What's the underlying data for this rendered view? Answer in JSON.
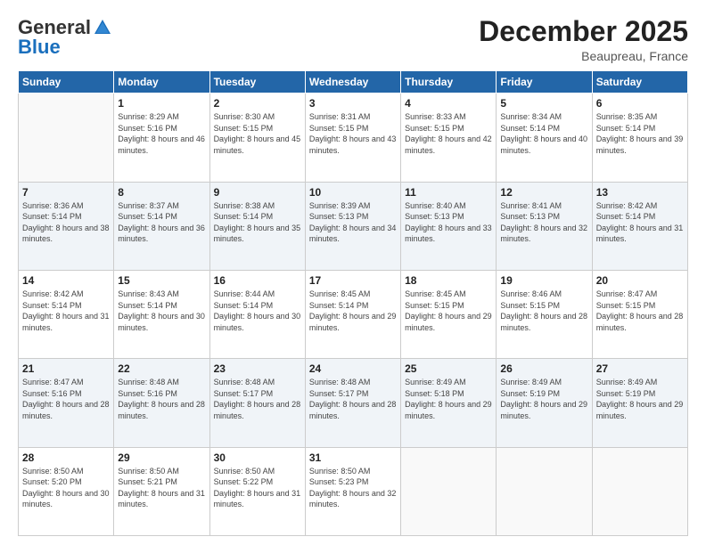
{
  "logo": {
    "general": "General",
    "blue": "Blue"
  },
  "header": {
    "month": "December 2025",
    "location": "Beaupreau, France"
  },
  "weekdays": [
    "Sunday",
    "Monday",
    "Tuesday",
    "Wednesday",
    "Thursday",
    "Friday",
    "Saturday"
  ],
  "weeks": [
    [
      {
        "day": "",
        "sunrise": "",
        "sunset": "",
        "daylight": ""
      },
      {
        "day": "1",
        "sunrise": "Sunrise: 8:29 AM",
        "sunset": "Sunset: 5:16 PM",
        "daylight": "Daylight: 8 hours and 46 minutes."
      },
      {
        "day": "2",
        "sunrise": "Sunrise: 8:30 AM",
        "sunset": "Sunset: 5:15 PM",
        "daylight": "Daylight: 8 hours and 45 minutes."
      },
      {
        "day": "3",
        "sunrise": "Sunrise: 8:31 AM",
        "sunset": "Sunset: 5:15 PM",
        "daylight": "Daylight: 8 hours and 43 minutes."
      },
      {
        "day": "4",
        "sunrise": "Sunrise: 8:33 AM",
        "sunset": "Sunset: 5:15 PM",
        "daylight": "Daylight: 8 hours and 42 minutes."
      },
      {
        "day": "5",
        "sunrise": "Sunrise: 8:34 AM",
        "sunset": "Sunset: 5:14 PM",
        "daylight": "Daylight: 8 hours and 40 minutes."
      },
      {
        "day": "6",
        "sunrise": "Sunrise: 8:35 AM",
        "sunset": "Sunset: 5:14 PM",
        "daylight": "Daylight: 8 hours and 39 minutes."
      }
    ],
    [
      {
        "day": "7",
        "sunrise": "Sunrise: 8:36 AM",
        "sunset": "Sunset: 5:14 PM",
        "daylight": "Daylight: 8 hours and 38 minutes."
      },
      {
        "day": "8",
        "sunrise": "Sunrise: 8:37 AM",
        "sunset": "Sunset: 5:14 PM",
        "daylight": "Daylight: 8 hours and 36 minutes."
      },
      {
        "day": "9",
        "sunrise": "Sunrise: 8:38 AM",
        "sunset": "Sunset: 5:14 PM",
        "daylight": "Daylight: 8 hours and 35 minutes."
      },
      {
        "day": "10",
        "sunrise": "Sunrise: 8:39 AM",
        "sunset": "Sunset: 5:13 PM",
        "daylight": "Daylight: 8 hours and 34 minutes."
      },
      {
        "day": "11",
        "sunrise": "Sunrise: 8:40 AM",
        "sunset": "Sunset: 5:13 PM",
        "daylight": "Daylight: 8 hours and 33 minutes."
      },
      {
        "day": "12",
        "sunrise": "Sunrise: 8:41 AM",
        "sunset": "Sunset: 5:13 PM",
        "daylight": "Daylight: 8 hours and 32 minutes."
      },
      {
        "day": "13",
        "sunrise": "Sunrise: 8:42 AM",
        "sunset": "Sunset: 5:14 PM",
        "daylight": "Daylight: 8 hours and 31 minutes."
      }
    ],
    [
      {
        "day": "14",
        "sunrise": "Sunrise: 8:42 AM",
        "sunset": "Sunset: 5:14 PM",
        "daylight": "Daylight: 8 hours and 31 minutes."
      },
      {
        "day": "15",
        "sunrise": "Sunrise: 8:43 AM",
        "sunset": "Sunset: 5:14 PM",
        "daylight": "Daylight: 8 hours and 30 minutes."
      },
      {
        "day": "16",
        "sunrise": "Sunrise: 8:44 AM",
        "sunset": "Sunset: 5:14 PM",
        "daylight": "Daylight: 8 hours and 30 minutes."
      },
      {
        "day": "17",
        "sunrise": "Sunrise: 8:45 AM",
        "sunset": "Sunset: 5:14 PM",
        "daylight": "Daylight: 8 hours and 29 minutes."
      },
      {
        "day": "18",
        "sunrise": "Sunrise: 8:45 AM",
        "sunset": "Sunset: 5:15 PM",
        "daylight": "Daylight: 8 hours and 29 minutes."
      },
      {
        "day": "19",
        "sunrise": "Sunrise: 8:46 AM",
        "sunset": "Sunset: 5:15 PM",
        "daylight": "Daylight: 8 hours and 28 minutes."
      },
      {
        "day": "20",
        "sunrise": "Sunrise: 8:47 AM",
        "sunset": "Sunset: 5:15 PM",
        "daylight": "Daylight: 8 hours and 28 minutes."
      }
    ],
    [
      {
        "day": "21",
        "sunrise": "Sunrise: 8:47 AM",
        "sunset": "Sunset: 5:16 PM",
        "daylight": "Daylight: 8 hours and 28 minutes."
      },
      {
        "day": "22",
        "sunrise": "Sunrise: 8:48 AM",
        "sunset": "Sunset: 5:16 PM",
        "daylight": "Daylight: 8 hours and 28 minutes."
      },
      {
        "day": "23",
        "sunrise": "Sunrise: 8:48 AM",
        "sunset": "Sunset: 5:17 PM",
        "daylight": "Daylight: 8 hours and 28 minutes."
      },
      {
        "day": "24",
        "sunrise": "Sunrise: 8:48 AM",
        "sunset": "Sunset: 5:17 PM",
        "daylight": "Daylight: 8 hours and 28 minutes."
      },
      {
        "day": "25",
        "sunrise": "Sunrise: 8:49 AM",
        "sunset": "Sunset: 5:18 PM",
        "daylight": "Daylight: 8 hours and 29 minutes."
      },
      {
        "day": "26",
        "sunrise": "Sunrise: 8:49 AM",
        "sunset": "Sunset: 5:19 PM",
        "daylight": "Daylight: 8 hours and 29 minutes."
      },
      {
        "day": "27",
        "sunrise": "Sunrise: 8:49 AM",
        "sunset": "Sunset: 5:19 PM",
        "daylight": "Daylight: 8 hours and 29 minutes."
      }
    ],
    [
      {
        "day": "28",
        "sunrise": "Sunrise: 8:50 AM",
        "sunset": "Sunset: 5:20 PM",
        "daylight": "Daylight: 8 hours and 30 minutes."
      },
      {
        "day": "29",
        "sunrise": "Sunrise: 8:50 AM",
        "sunset": "Sunset: 5:21 PM",
        "daylight": "Daylight: 8 hours and 31 minutes."
      },
      {
        "day": "30",
        "sunrise": "Sunrise: 8:50 AM",
        "sunset": "Sunset: 5:22 PM",
        "daylight": "Daylight: 8 hours and 31 minutes."
      },
      {
        "day": "31",
        "sunrise": "Sunrise: 8:50 AM",
        "sunset": "Sunset: 5:23 PM",
        "daylight": "Daylight: 8 hours and 32 minutes."
      },
      {
        "day": "",
        "sunrise": "",
        "sunset": "",
        "daylight": ""
      },
      {
        "day": "",
        "sunrise": "",
        "sunset": "",
        "daylight": ""
      },
      {
        "day": "",
        "sunrise": "",
        "sunset": "",
        "daylight": ""
      }
    ]
  ]
}
